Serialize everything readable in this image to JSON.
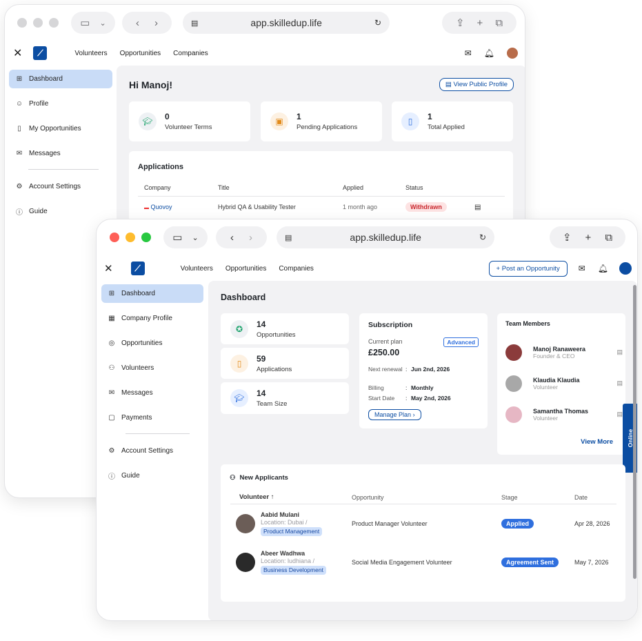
{
  "back": {
    "url": "app.skilledup.life",
    "nav": [
      "Volunteers",
      "Opportunities",
      "Companies"
    ],
    "sidebar": [
      {
        "label": "Dashboard",
        "icon": "grid-icon"
      },
      {
        "label": "Profile",
        "icon": "user-icon"
      },
      {
        "label": "My Opportunities",
        "icon": "clipboard-icon"
      },
      {
        "label": "Messages",
        "icon": "mail-icon"
      },
      {
        "label": "Account Settings",
        "icon": "gear-icon"
      },
      {
        "label": "Guide",
        "icon": "info-icon"
      }
    ],
    "greeting": "Hi Manoj!",
    "view_profile": "View Public Profile",
    "stats": [
      {
        "value": "0",
        "label": "Volunteer Terms",
        "icon": "graduation-cap-icon"
      },
      {
        "value": "1",
        "label": "Pending Applications",
        "icon": "briefcase-icon"
      },
      {
        "value": "1",
        "label": "Total Applied",
        "icon": "clipboard-icon"
      }
    ],
    "applications": {
      "title": "Applications",
      "headers": [
        "Company",
        "Title",
        "Applied",
        "Status"
      ],
      "rows": [
        {
          "company": "Quovoy",
          "title": "Hybrid QA & Usability Tester",
          "applied": "1 month ago",
          "status": "Withdrawn"
        }
      ]
    }
  },
  "front": {
    "url": "app.skilledup.life",
    "nav": [
      "Volunteers",
      "Opportunities",
      "Companies"
    ],
    "post_button": "Post an Opportunity",
    "sidebar": [
      {
        "label": "Dashboard",
        "icon": "grid-icon"
      },
      {
        "label": "Company Profile",
        "icon": "building-icon"
      },
      {
        "label": "Opportunities",
        "icon": "target-icon"
      },
      {
        "label": "Volunteers",
        "icon": "people-icon"
      },
      {
        "label": "Messages",
        "icon": "mail-icon"
      },
      {
        "label": "Payments",
        "icon": "wallet-icon"
      },
      {
        "label": "Account Settings",
        "icon": "gear-icon"
      },
      {
        "label": "Guide",
        "icon": "info-icon"
      }
    ],
    "page_title": "Dashboard",
    "stats": [
      {
        "value": "14",
        "label": "Opportunities",
        "icon": "award-icon"
      },
      {
        "value": "59",
        "label": "Applications",
        "icon": "clipboard-icon"
      },
      {
        "value": "14",
        "label": "Team Size",
        "icon": "graduation-cap-icon"
      }
    ],
    "subscription": {
      "title": "Subscription",
      "current_plan_label": "Current plan",
      "plan_badge": "Advanced",
      "price": "£250.00",
      "rows": [
        {
          "label": "Next renewal",
          "value": "Jun 2nd, 2026"
        },
        {
          "label": "Billing",
          "value": "Monthly"
        },
        {
          "label": "Start Date",
          "value": "May 2nd, 2026"
        }
      ],
      "manage": "Manage Plan"
    },
    "team": {
      "title": "Team Members",
      "members": [
        {
          "name": "Manoj Ranaweera",
          "role": "Founder & CEO"
        },
        {
          "name": "Klaudia Klaudia",
          "role": "Volunteer"
        },
        {
          "name": "Samantha Thomas",
          "role": "Volunteer"
        }
      ],
      "view_more": "View More"
    },
    "online_tab": "Online",
    "applicants": {
      "title": "New Applicants",
      "headers": [
        "Volunteer",
        "Opportunity",
        "Stage",
        "Date"
      ],
      "rows": [
        {
          "name": "Aabid Mulani",
          "location": "Location: Dubai /",
          "tag": "Product Management",
          "opportunity": "Product Manager Volunteer",
          "stage": "Applied",
          "date": "Apr 28, 2026"
        },
        {
          "name": "Abeer Wadhwa",
          "location": "Location: ludhiana /",
          "tag": "Business Development",
          "opportunity": "Social Media Engagement Volunteer",
          "stage": "Agreement Sent",
          "date": "May 7, 2026"
        }
      ]
    }
  },
  "colors": {
    "brand": "#0b4da2",
    "active": "#c9dcf7",
    "withdrawn": "#fde3e3",
    "stage": "#2f6fde"
  }
}
